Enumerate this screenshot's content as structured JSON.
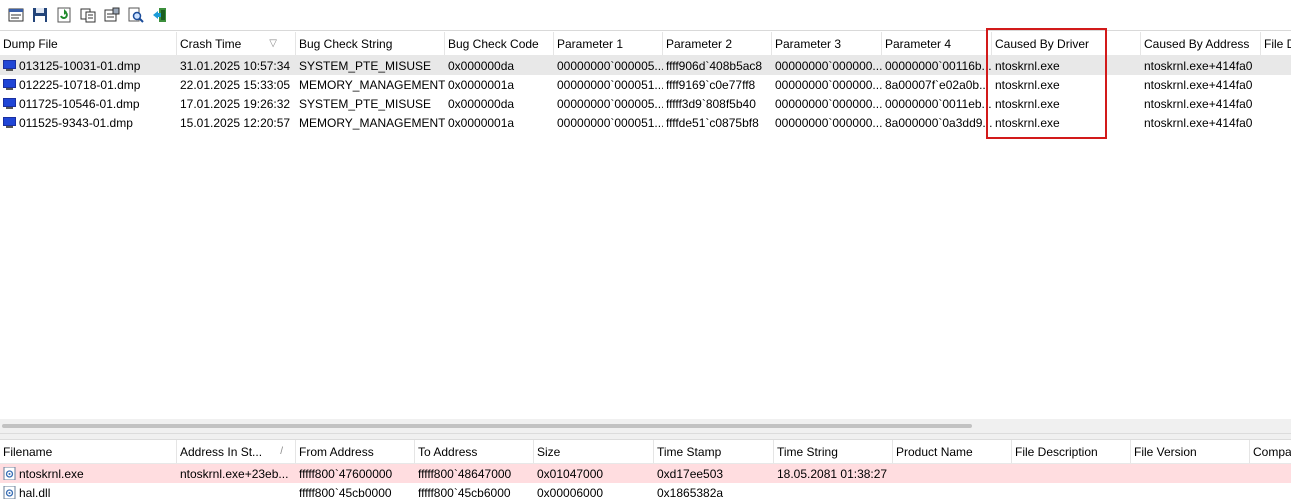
{
  "toolbar": {
    "buttons": [
      {
        "name": "html-report-button",
        "icon": "report-icon"
      },
      {
        "name": "save-button",
        "icon": "floppy-disk-icon"
      },
      {
        "name": "refresh-button",
        "icon": "refresh-icon"
      },
      {
        "name": "copy-button",
        "icon": "copy-icon"
      },
      {
        "name": "properties-button",
        "icon": "properties-icon"
      },
      {
        "name": "find-button",
        "icon": "find-icon"
      },
      {
        "name": "exit-button",
        "icon": "exit-icon"
      }
    ]
  },
  "crash_list": {
    "columns": [
      "Dump File",
      "Crash Time",
      "Bug Check String",
      "Bug Check Code",
      "Parameter 1",
      "Parameter 2",
      "Parameter 3",
      "Parameter 4",
      "Caused By Driver",
      "Caused By Address",
      "File D"
    ],
    "rows": [
      [
        "013125-10031-01.dmp",
        "31.01.2025 10:57:34",
        "SYSTEM_PTE_MISUSE",
        "0x000000da",
        "00000000`000005...",
        "ffff906d`408b5ac8",
        "00000000`000000...",
        "00000000`00116b...",
        "ntoskrnl.exe",
        "ntoskrnl.exe+414fa0",
        ""
      ],
      [
        "012225-10718-01.dmp",
        "22.01.2025 15:33:05",
        "MEMORY_MANAGEMENT",
        "0x0000001a",
        "00000000`000051...",
        "ffff9169`c0e77ff8",
        "00000000`000000...",
        "8a00007f`e02a0b...",
        "ntoskrnl.exe",
        "ntoskrnl.exe+414fa0",
        ""
      ],
      [
        "011725-10546-01.dmp",
        "17.01.2025 19:26:32",
        "SYSTEM_PTE_MISUSE",
        "0x000000da",
        "00000000`000005...",
        "fffff3d9`808f5b40",
        "00000000`000000...",
        "00000000`0011eb...",
        "ntoskrnl.exe",
        "ntoskrnl.exe+414fa0",
        ""
      ],
      [
        "011525-9343-01.dmp",
        "15.01.2025 12:20:57",
        "MEMORY_MANAGEMENT",
        "0x0000001a",
        "00000000`000051...",
        "ffffde51`c0875bf8",
        "00000000`000000...",
        "8a000000`0a3dd9...",
        "ntoskrnl.exe",
        "ntoskrnl.exe+414fa0",
        ""
      ]
    ]
  },
  "driver_list": {
    "columns": [
      "Filename",
      "Address In St...",
      "From Address",
      "To Address",
      "Size",
      "Time Stamp",
      "Time String",
      "Product Name",
      "File Description",
      "File Version",
      "Compa"
    ],
    "rows": [
      [
        "ntoskrnl.exe",
        "ntoskrnl.exe+23eb...",
        "fffff800`47600000",
        "fffff800`48647000",
        "0x01047000",
        "0xd17ee503",
        "18.05.2081 01:38:27",
        "",
        "",
        "",
        ""
      ],
      [
        "hal.dll",
        "",
        "fffff800`45cb0000",
        "fffff800`45cb6000",
        "0x00006000",
        "0x1865382a",
        "",
        "",
        "",
        "",
        ""
      ]
    ]
  },
  "colors": {
    "highlight_box": "#d21a1a",
    "selected_row": "#e8e8e8",
    "highlighted_driver_row": "#ffdde0"
  }
}
